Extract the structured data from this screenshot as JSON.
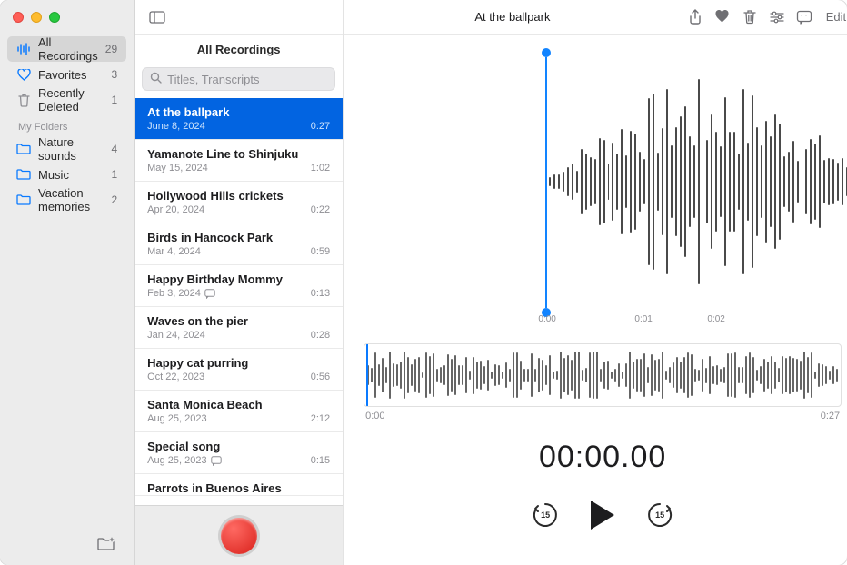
{
  "window_title": "At the ballpark",
  "toolbar": {
    "edit_label": "Edit"
  },
  "sidebar": {
    "smart": [
      {
        "icon": "waveform",
        "label": "All Recordings",
        "count": "29",
        "selected": true
      },
      {
        "icon": "heart",
        "label": "Favorites",
        "count": "3"
      },
      {
        "icon": "trash",
        "label": "Recently Deleted",
        "count": "1"
      }
    ],
    "my_folders_label": "My Folders",
    "folders": [
      {
        "label": "Nature sounds",
        "count": "4"
      },
      {
        "label": "Music",
        "count": "1"
      },
      {
        "label": "Vacation memories",
        "count": "2"
      }
    ]
  },
  "middle": {
    "title": "All Recordings",
    "search_placeholder": "Titles, Transcripts",
    "recordings": [
      {
        "title": "At the ballpark",
        "date": "June 8, 2024",
        "dur": "0:27",
        "selected": true
      },
      {
        "title": "Yamanote Line to Shinjuku",
        "date": "May 15, 2024",
        "dur": "1:02"
      },
      {
        "title": "Hollywood Hills crickets",
        "date": "Apr 20, 2024",
        "dur": "0:22"
      },
      {
        "title": "Birds in Hancock Park",
        "date": "Mar 4, 2024",
        "dur": "0:59"
      },
      {
        "title": "Happy Birthday Mommy",
        "date": "Feb 3, 2024",
        "dur": "0:13",
        "transcript": true
      },
      {
        "title": "Waves on the pier",
        "date": "Jan 24, 2024",
        "dur": "0:28"
      },
      {
        "title": "Happy cat purring",
        "date": "Oct 22, 2023",
        "dur": "0:56"
      },
      {
        "title": "Santa Monica Beach",
        "date": "Aug 25, 2023",
        "dur": "2:12"
      },
      {
        "title": "Special song",
        "date": "Aug 25, 2023",
        "dur": "0:15",
        "transcript": true
      },
      {
        "title": "Parrots in Buenos Aires",
        "date": "",
        "dur": ""
      }
    ]
  },
  "detail": {
    "zoom_ticks": [
      "0:00",
      "0:01",
      "0:02"
    ],
    "scrub_start": "0:00",
    "scrub_end": "0:27",
    "time_display": "00:00.00",
    "skip_seconds": "15"
  },
  "colors": {
    "accent": "#0a7aff",
    "selection": "#0264e1"
  }
}
